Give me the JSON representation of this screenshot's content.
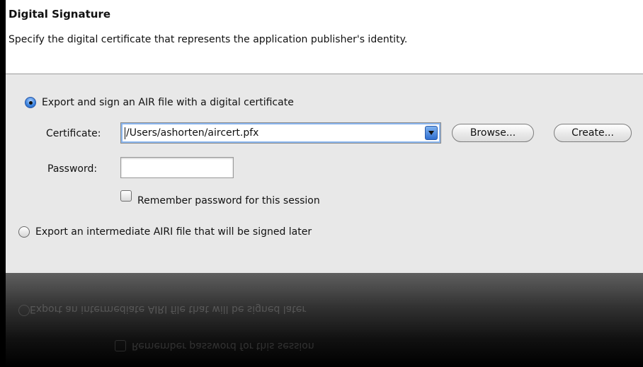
{
  "header": {
    "title": "Digital Signature",
    "subtitle": "Specify the digital certificate that represents the application publisher's identity."
  },
  "options": {
    "sign": {
      "label": "Export and sign an AIR file with a digital certificate",
      "selected": true
    },
    "intermediate": {
      "label": "Export an intermediate AIRI file that will be signed later",
      "selected": false
    }
  },
  "certificate": {
    "label": "Certificate:",
    "value": "/Users/ashorten/aircert.pfx",
    "browse_label": "Browse...",
    "create_label": "Create..."
  },
  "password": {
    "label": "Password:",
    "value": ""
  },
  "remember": {
    "label": "Remember password for this session",
    "checked": false
  },
  "colors": {
    "header_bg": "#ffffff",
    "panel_bg": "#e8e8e8",
    "accent": "#3f86e0"
  }
}
